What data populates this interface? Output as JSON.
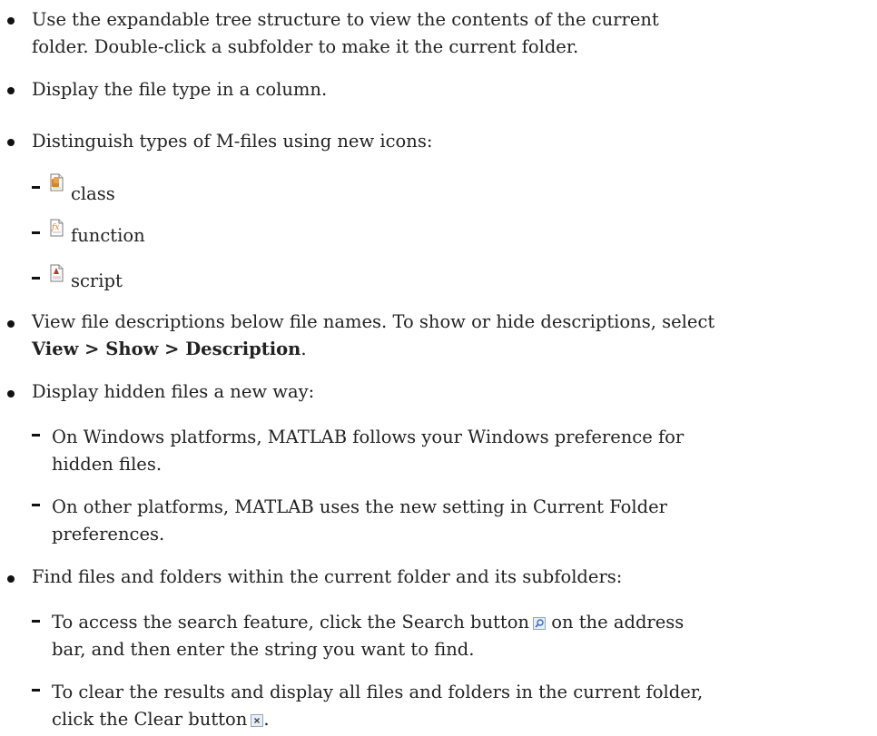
{
  "bullets": {
    "tree": {
      "line1": "Use the expandable tree structure to view the contents of the current",
      "line2": "folder. Double-click a subfolder to make it the current folder."
    },
    "filetype": {
      "line1": "Display the file type in a column."
    },
    "mfiles": {
      "line1": "Distinguish types of M-files using new icons:",
      "items": [
        {
          "label": "class",
          "icon": "class-file-icon"
        },
        {
          "label": "function",
          "icon": "function-file-icon"
        },
        {
          "label": "script",
          "icon": "script-file-icon"
        }
      ]
    },
    "descriptions": {
      "line1": "View file descriptions below file names. To show or hide descriptions, select",
      "menu_path": "View > Show > Description",
      "period": "."
    },
    "hidden": {
      "line1": "Display hidden files a new way:",
      "sub1_line1": "On Windows platforms, MATLAB follows your Windows preference for",
      "sub1_line2": "hidden files.",
      "sub2_line1": "On other platforms, MATLAB uses the new setting in Current Folder",
      "sub2_line2": "preferences."
    },
    "find": {
      "line1": "Find files and folders within the current folder and its subfolders:",
      "sub1_line1": "To access the search feature, click the Search button",
      "sub1_line1_after": "on the address",
      "sub1_line2": "bar, and then enter the string you want to find.",
      "sub2_line1": "To clear the results and display all files and folders in the current folder,",
      "sub2_line2": "click the Clear button",
      "sub2_line2_after": "."
    }
  },
  "colors": {
    "text": "#222222",
    "class_icon": "#d9822b",
    "function_icon": "#e07a2a",
    "script_icon": "#c0392b",
    "button_bg": "#e8eef6",
    "button_border": "#8fa6c4"
  }
}
